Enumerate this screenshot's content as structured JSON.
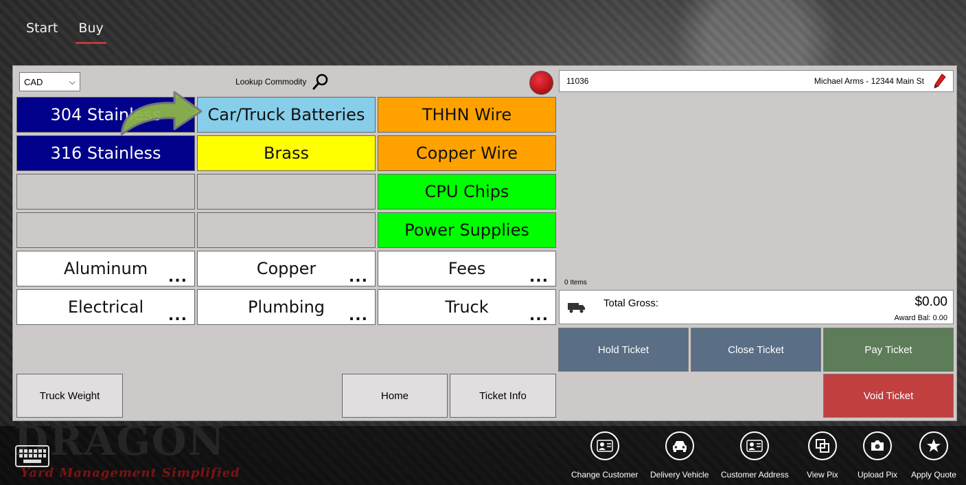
{
  "nav": {
    "tabs": [
      {
        "label": "Start"
      },
      {
        "label": "Buy"
      }
    ]
  },
  "currency": {
    "selected": "CAD"
  },
  "lookup": {
    "label": "Lookup Commodity"
  },
  "commodities": {
    "c0": [
      "304 Stainless",
      "316 Stainless",
      "",
      "",
      "Aluminum",
      "Electrical"
    ],
    "c1": [
      "Car/Truck Batteries",
      "Brass",
      "",
      "",
      "Copper",
      "Plumbing"
    ],
    "c2": [
      "THHN Wire",
      "Copper Wire",
      "CPU Chips",
      "Power Supplies",
      "Fees",
      "Truck"
    ],
    "more": "..."
  },
  "footer": {
    "truck_weight": "Truck Weight",
    "home": "Home",
    "ticket_info": "Ticket Info"
  },
  "customer": {
    "id": "11036",
    "name": "Michael Arms  -  12344 Main St"
  },
  "ticket": {
    "items_count": "0  Items",
    "total_label": "Total Gross:",
    "total_amount": "$0.00",
    "award_balance": "Award Bal:  0.00"
  },
  "actions": {
    "hold": "Hold Ticket",
    "close": "Close Ticket",
    "pay": "Pay Ticket",
    "void": "Void Ticket"
  },
  "branding": {
    "logo": "DRAGON",
    "tagline": "Yard Management Simplified"
  },
  "appbar": [
    {
      "label": "Change Customer",
      "icon": "contact-card-icon"
    },
    {
      "label": "Delivery Vehicle",
      "icon": "car-icon"
    },
    {
      "label": "Customer Address",
      "icon": "contact-card-icon"
    },
    {
      "label": "View Pix",
      "icon": "copy-icon"
    },
    {
      "label": "Upload Pix",
      "icon": "camera-icon"
    },
    {
      "label": "Apply Quote",
      "icon": "star-icon"
    }
  ],
  "colors": {
    "navy": "#00008a",
    "light_blue": "#87ceea",
    "yellow": "#ffff00",
    "orange": "#ffa200",
    "green": "#00ff00",
    "hold_close": "#5a6e85",
    "pay": "#5d7c58",
    "void": "#c23f3f"
  }
}
